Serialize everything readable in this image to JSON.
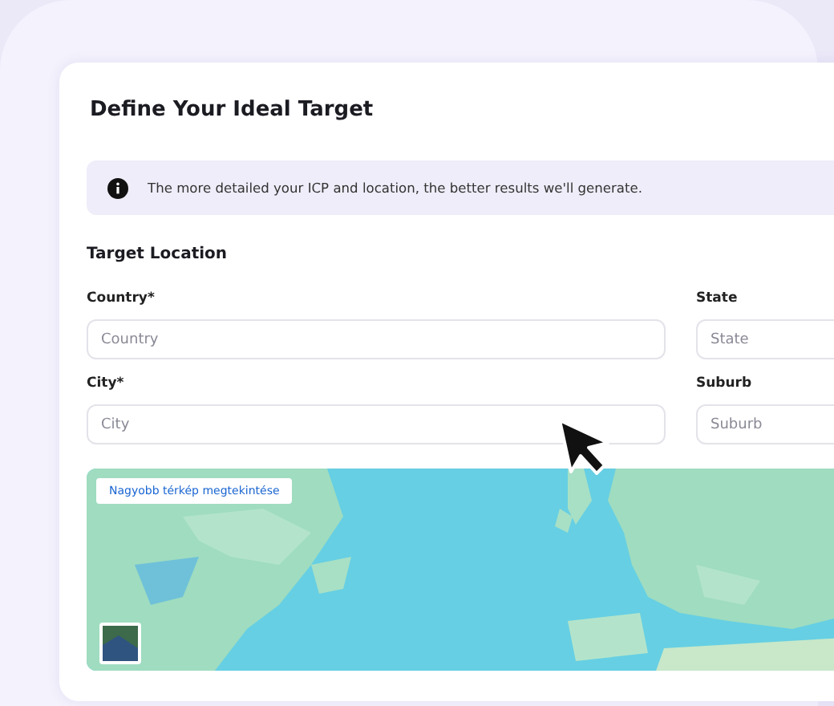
{
  "card": {
    "title": "Define Your Ideal Target",
    "info": "The more detailed your ICP and location, the better results we'll generate.",
    "section": "Target Location",
    "fields": [
      {
        "label": "Country*",
        "placeholder": "Country"
      },
      {
        "label": "State",
        "placeholder": "State"
      },
      {
        "label": "City*",
        "placeholder": "City"
      },
      {
        "label": "Suburb",
        "placeholder": "Suburb"
      }
    ],
    "map": {
      "kind": "picture",
      "button": "Nagyobb térkép megtekintése"
    }
  }
}
